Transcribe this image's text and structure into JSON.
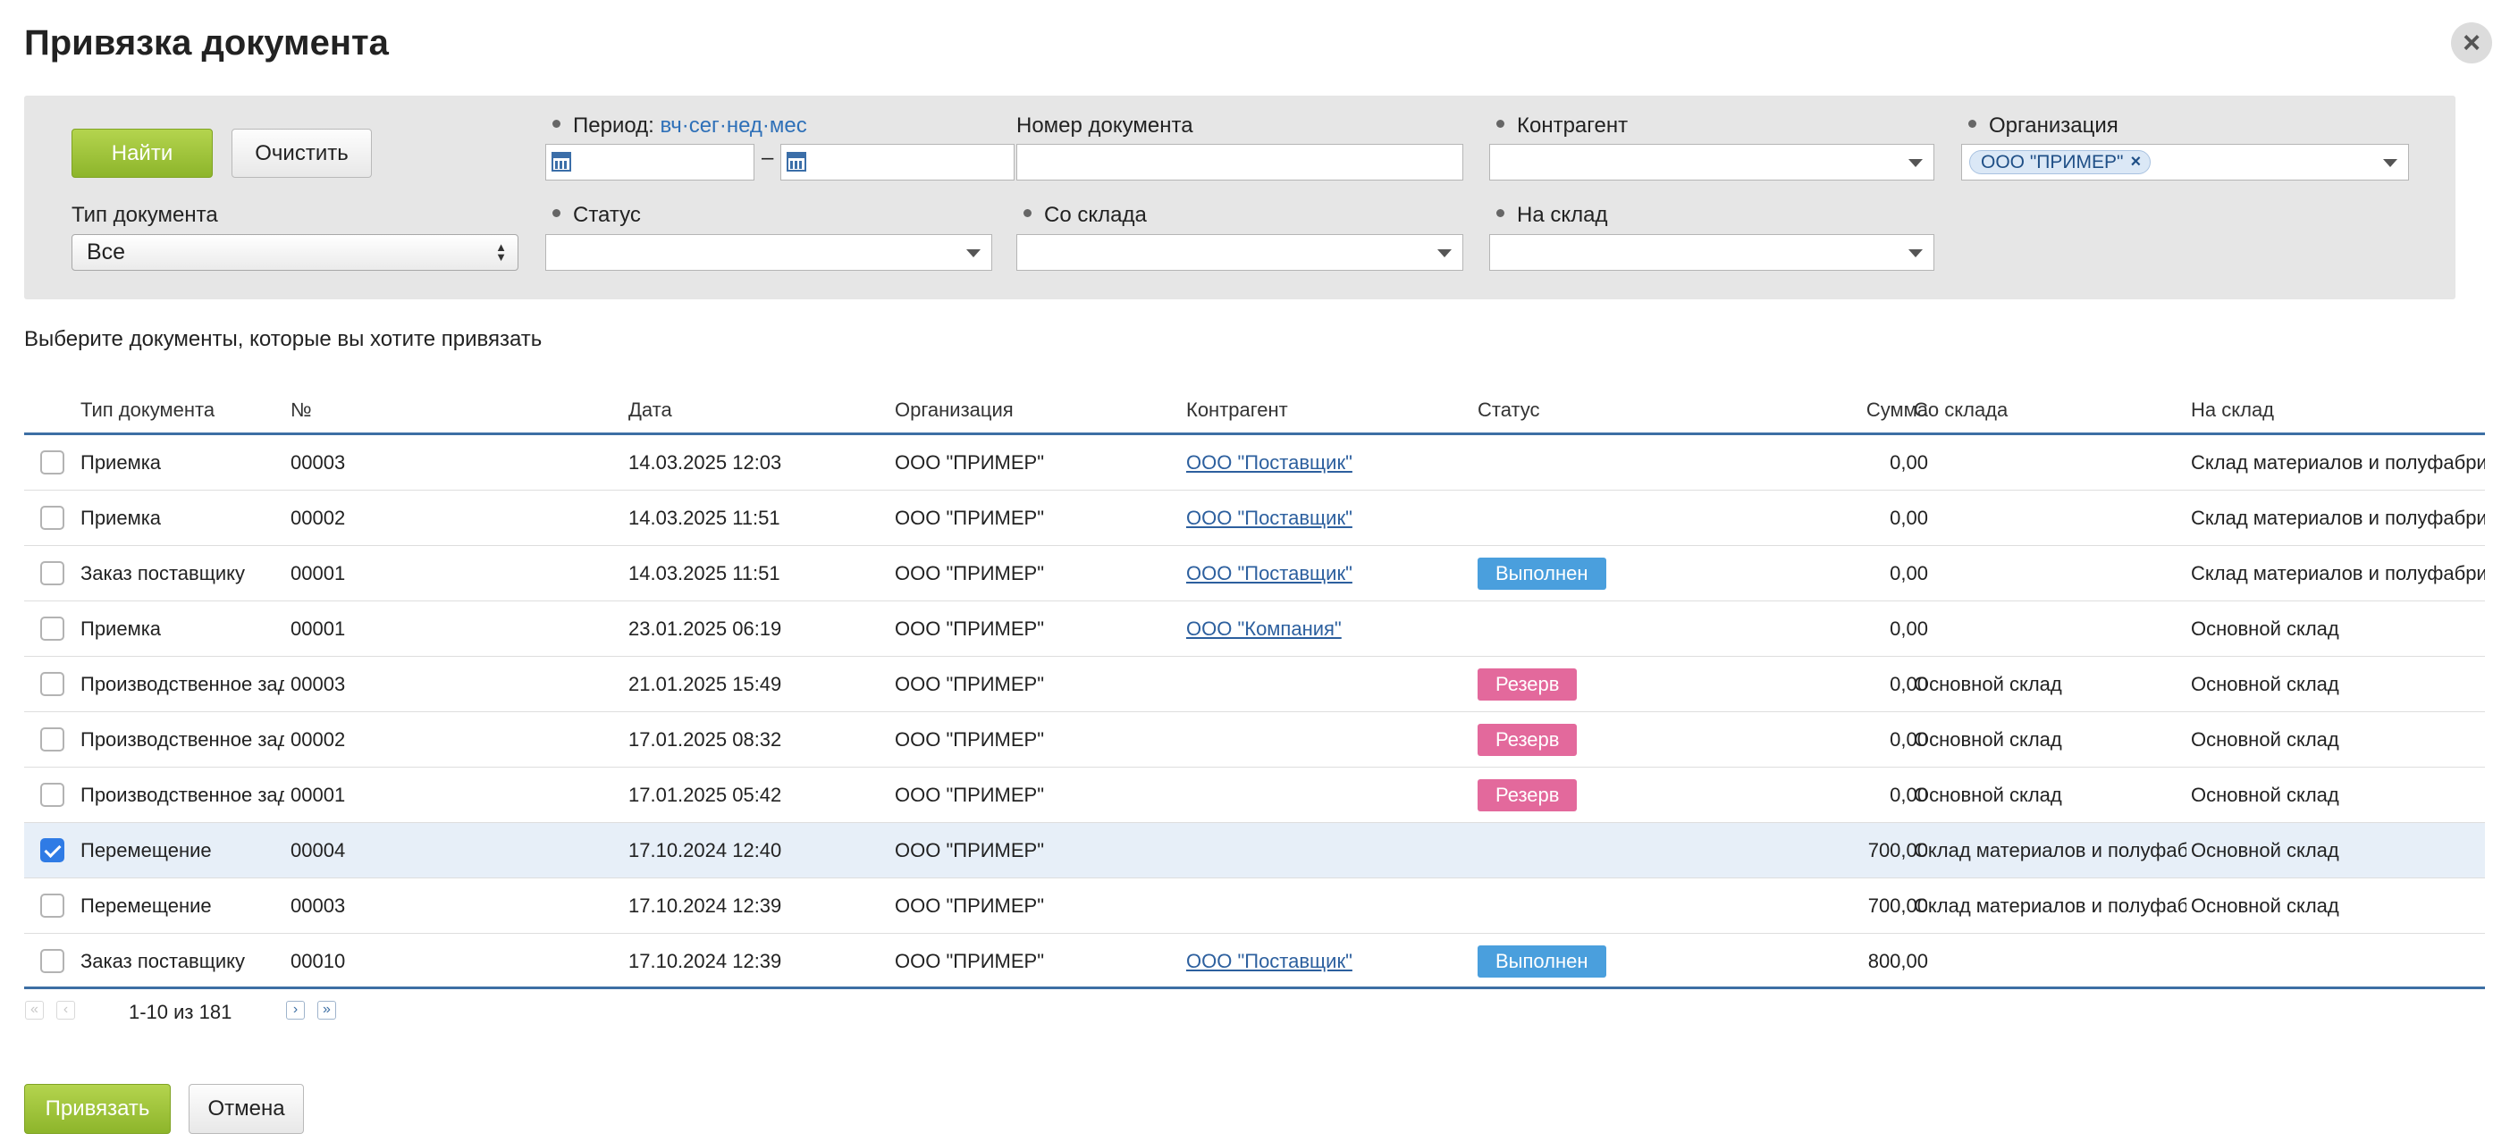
{
  "dialog": {
    "title": "Привязка документа",
    "close_icon": "close-icon"
  },
  "filter": {
    "find_button": "Найти",
    "clear_button": "Очистить",
    "period_label": "Период:",
    "period_links": [
      "вч",
      "сег",
      "нед",
      "мес"
    ],
    "period_separator": "·",
    "date_dash": "–",
    "doc_number_label": "Номер документа",
    "counterparty_label": "Контрагент",
    "organization_label": "Организация",
    "organization_chip": "ООО \"ПРИМЕР\"",
    "doc_type_label": "Тип документа",
    "doc_type_value": "Все",
    "status_label": "Статус",
    "from_warehouse_label": "Со склада",
    "to_warehouse_label": "На склад"
  },
  "hint": "Выберите документы, которые вы хотите привязать",
  "table": {
    "columns": [
      "Тип документа",
      "№",
      "Дата",
      "Организация",
      "Контрагент",
      "Статус",
      "Сумма",
      "Со склада",
      "На склад"
    ],
    "rows": [
      {
        "checked": false,
        "type": "Приемка",
        "number": "00003",
        "date": "14.03.2025 12:03",
        "org": "ООО \"ПРИМЕР\"",
        "counterparty": "ООО \"Поставщик\"",
        "status": "",
        "sum": "0,00",
        "from": "",
        "to": "Склад материалов и полуфабрикатов"
      },
      {
        "checked": false,
        "type": "Приемка",
        "number": "00002",
        "date": "14.03.2025 11:51",
        "org": "ООО \"ПРИМЕР\"",
        "counterparty": "ООО \"Поставщик\"",
        "status": "",
        "sum": "0,00",
        "from": "",
        "to": "Склад материалов и полуфабрикатов"
      },
      {
        "checked": false,
        "type": "Заказ поставщику",
        "number": "00001",
        "date": "14.03.2025 11:51",
        "org": "ООО \"ПРИМЕР\"",
        "counterparty": "ООО \"Поставщик\"",
        "status": "Выполнен",
        "sum": "0,00",
        "from": "",
        "to": "Склад материалов и полуфабрикатов"
      },
      {
        "checked": false,
        "type": "Приемка",
        "number": "00001",
        "date": "23.01.2025 06:19",
        "org": "ООО \"ПРИМЕР\"",
        "counterparty": "ООО \"Компания\"",
        "status": "",
        "sum": "0,00",
        "from": "",
        "to": "Основной склад"
      },
      {
        "checked": false,
        "type": "Производственное задание",
        "number": "00003",
        "date": "21.01.2025 15:49",
        "org": "ООО \"ПРИМЕР\"",
        "counterparty": "",
        "status": "Резерв",
        "sum": "0,00",
        "from": "Основной склад",
        "to": "Основной склад"
      },
      {
        "checked": false,
        "type": "Производственное задание",
        "number": "00002",
        "date": "17.01.2025 08:32",
        "org": "ООО \"ПРИМЕР\"",
        "counterparty": "",
        "status": "Резерв",
        "sum": "0,00",
        "from": "Основной склад",
        "to": "Основной склад"
      },
      {
        "checked": false,
        "type": "Производственное задание",
        "number": "00001",
        "date": "17.01.2025 05:42",
        "org": "ООО \"ПРИМЕР\"",
        "counterparty": "",
        "status": "Резерв",
        "sum": "0,00",
        "from": "Основной склад",
        "to": "Основной склад"
      },
      {
        "checked": true,
        "type": "Перемещение",
        "number": "00004",
        "date": "17.10.2024 12:40",
        "org": "ООО \"ПРИМЕР\"",
        "counterparty": "",
        "status": "",
        "sum": "700,00",
        "from": "Склад материалов и полуфабрикатов",
        "to": "Основной склад"
      },
      {
        "checked": false,
        "type": "Перемещение",
        "number": "00003",
        "date": "17.10.2024 12:39",
        "org": "ООО \"ПРИМЕР\"",
        "counterparty": "",
        "status": "",
        "sum": "700,00",
        "from": "Склад материалов и полуфабрикатов",
        "to": "Основной склад"
      },
      {
        "checked": false,
        "type": "Заказ поставщику",
        "number": "00010",
        "date": "17.10.2024 12:39",
        "org": "ООО \"ПРИМЕР\"",
        "counterparty": "ООО \"Поставщик\"",
        "status": "Выполнен",
        "sum": "800,00",
        "from": "",
        "to": ""
      }
    ]
  },
  "status_colors": {
    "Выполнен": "#4a9fdd",
    "Резерв": "#e3699c"
  },
  "pagination": {
    "range": "1-10 из 181",
    "first_icon": "«",
    "prev_icon": "‹",
    "next_icon": "›",
    "last_icon": "»"
  },
  "footer": {
    "bind_button": "Привязать",
    "cancel_button": "Отмена"
  }
}
